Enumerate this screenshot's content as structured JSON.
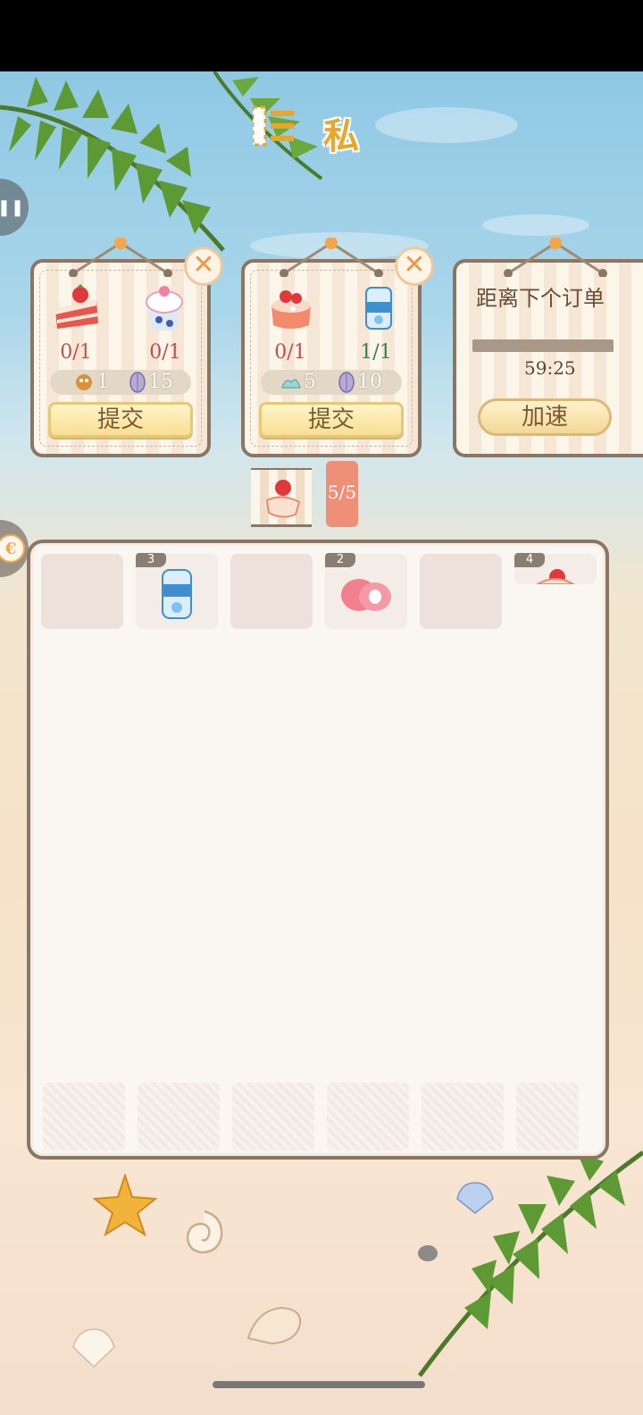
{
  "header": {
    "title": "私"
  },
  "orders": [
    {
      "items": [
        {
          "icon": "strawberry-cake-icon",
          "count": "0/1",
          "count_color": "#c0504a"
        },
        {
          "icon": "ice-cream-cup-icon",
          "count": "0/1",
          "count_color": "#c0504a"
        }
      ],
      "rewards": [
        {
          "icon": "hermit-crab-icon",
          "value": "1"
        },
        {
          "icon": "shell-icon",
          "value": "15"
        }
      ],
      "submit_label": "提交"
    },
    {
      "items": [
        {
          "icon": "strawberry-mousse-icon",
          "count": "0/1",
          "count_color": "#c0504a"
        },
        {
          "icon": "soda-can-icon",
          "count": "1/1",
          "count_color": "#3e7a5a"
        }
      ],
      "rewards": [
        {
          "icon": "coral-icon",
          "value": "5"
        },
        {
          "icon": "shell-icon",
          "value": "10"
        }
      ],
      "submit_label": "提交"
    }
  ],
  "next_order": {
    "title": "距离下个订单",
    "timer": "59:25",
    "speed_label": "加速",
    "progress": 1.0
  },
  "pager": {
    "badge": "5/5"
  },
  "inventory": {
    "slots": [
      {
        "level": "",
        "icon": ""
      },
      {
        "level": "3",
        "icon": "soda-can-icon"
      },
      {
        "level": "",
        "icon": ""
      },
      {
        "level": "2",
        "icon": "strawberry-mochi-icon"
      },
      {
        "level": "",
        "icon": ""
      },
      {
        "level": "4",
        "icon": "strawberry-dessert-icon"
      }
    ]
  },
  "colors": {
    "frame": "#8a7662",
    "accent": "#e8a62a",
    "button": "#f7df92"
  }
}
